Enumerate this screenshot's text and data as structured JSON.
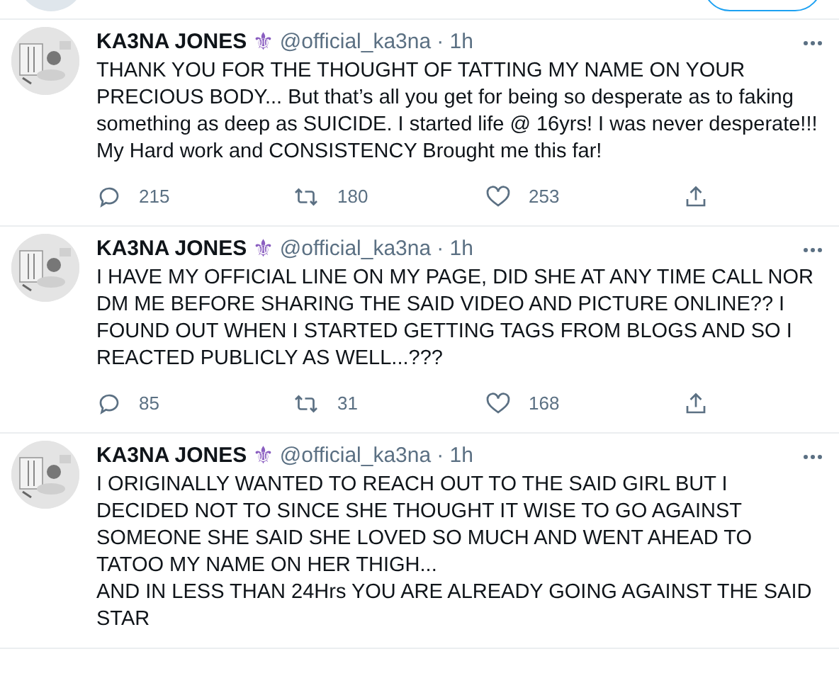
{
  "tweets": [
    {
      "name": "KA3NA JONES",
      "badge": "⚜",
      "handle": "@official_ka3na",
      "time": "· 1h",
      "text": "THANK YOU FOR THE THOUGHT OF TATTING MY NAME ON YOUR PRECIOUS BODY... But that’s all you get for being so desperate as to faking something as deep as SUICIDE. I started life @ 16yrs! I was never desperate!!!\nMy Hard work and CONSISTENCY Brought me this far!",
      "replies": "215",
      "retweets": "180",
      "likes": "253"
    },
    {
      "name": "KA3NA JONES",
      "badge": "⚜",
      "handle": "@official_ka3na",
      "time": "· 1h",
      "text": "I HAVE MY OFFICIAL LINE ON MY PAGE, DID SHE AT ANY TIME CALL NOR DM ME BEFORE SHARING THE SAID VIDEO AND PICTURE ONLINE?? I FOUND OUT WHEN I STARTED GETTING TAGS FROM BLOGS AND SO I REACTED PUBLICLY AS WELL...???",
      "replies": "85",
      "retweets": "31",
      "likes": "168"
    },
    {
      "name": "KA3NA JONES",
      "badge": "⚜",
      "handle": "@official_ka3na",
      "time": "· 1h",
      "text": "I ORIGINALLY WANTED TO REACH OUT TO THE SAID GIRL BUT I DECIDED NOT TO SINCE SHE THOUGHT IT WISE TO GO AGAINST SOMEONE SHE SAID SHE LOVED SO MUCH AND WENT AHEAD TO TATOO MY NAME ON HER THIGH...\nAND IN LESS THAN 24Hrs YOU ARE ALREADY GOING AGAINST THE SAID STAR"
    }
  ]
}
